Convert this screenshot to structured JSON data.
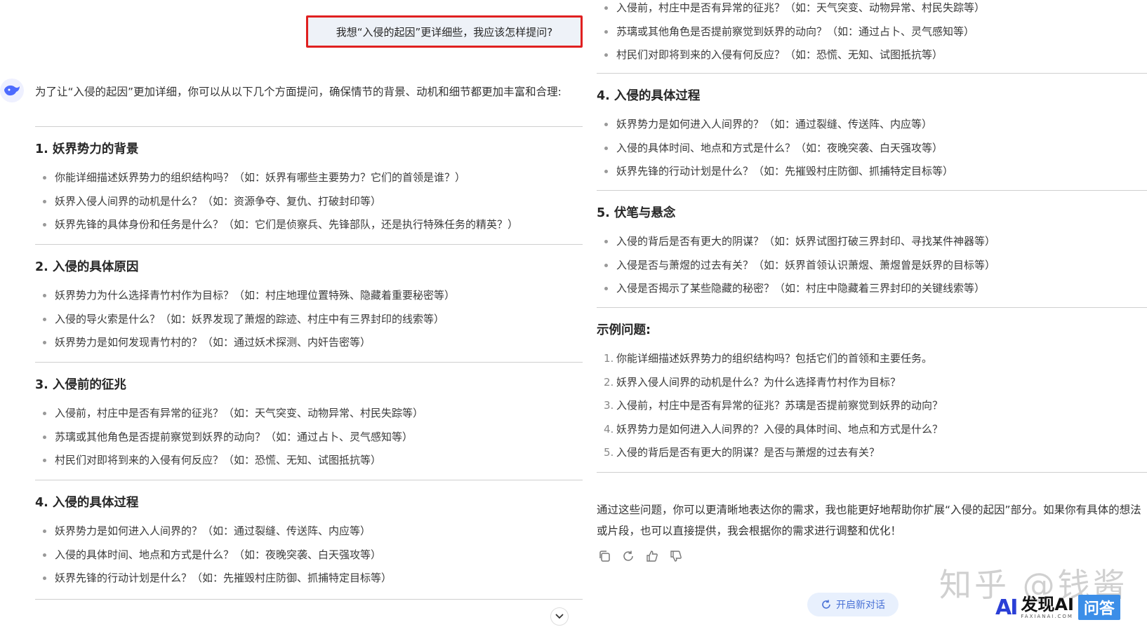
{
  "user_message": "我想“入侵的起因”更详细些，我应该怎样提问?",
  "intro": "为了让“入侵的起因”更加详细，你可以从以下几个方面提问，确保情节的背景、动机和细节都更加丰富和合理:",
  "left_sections": [
    {
      "title": "1. 妖界势力的背景",
      "items": [
        "你能详细描述妖界势力的组织结构吗？（如：妖界有哪些主要势力？它们的首领是谁？）",
        "妖界入侵人间界的动机是什么？（如：资源争夺、复仇、打破封印等）",
        "妖界先锋的具体身份和任务是什么？（如：它们是侦察兵、先锋部队，还是执行特殊任务的精英？）"
      ]
    },
    {
      "title": "2. 入侵的具体原因",
      "items": [
        "妖界势力为什么选择青竹村作为目标？（如：村庄地理位置特殊、隐藏着重要秘密等）",
        "入侵的导火索是什么？（如：妖界发现了萧煜的踪迹、村庄中有三界封印的线索等）",
        "妖界势力是如何发现青竹村的？（如：通过妖术探测、内奸告密等）"
      ]
    },
    {
      "title": "3. 入侵前的征兆",
      "items": [
        "入侵前，村庄中是否有异常的征兆？（如：天气突变、动物异常、村民失踪等）",
        "苏璃或其他角色是否提前察觉到妖界的动向？（如：通过占卜、灵气感知等）",
        "村民们对即将到来的入侵有何反应？（如：恐慌、无知、试图抵抗等）"
      ]
    },
    {
      "title": "4. 入侵的具体过程",
      "items": [
        "妖界势力是如何进入人间界的？（如：通过裂缝、传送阵、内应等）",
        "入侵的具体时间、地点和方式是什么？（如：夜晚突袭、白天强攻等）",
        "妖界先锋的行动计划是什么？（如：先摧毁村庄防御、抓捕特定目标等）"
      ]
    }
  ],
  "right_top_items": [
    "入侵前，村庄中是否有异常的征兆？（如：天气突变、动物异常、村民失踪等）",
    "苏璃或其他角色是否提前察觉到妖界的动向？（如：通过占卜、灵气感知等）",
    "村民们对即将到来的入侵有何反应？（如：恐慌、无知、试图抵抗等）"
  ],
  "right_sections": [
    {
      "title": "4. 入侵的具体过程",
      "items": [
        "妖界势力是如何进入人间界的？（如：通过裂缝、传送阵、内应等）",
        "入侵的具体时间、地点和方式是什么？（如：夜晚突袭、白天强攻等）",
        "妖界先锋的行动计划是什么？（如：先摧毁村庄防御、抓捕特定目标等）"
      ]
    },
    {
      "title": "5. 伏笔与悬念",
      "items": [
        "入侵的背后是否有更大的阴谋？（如：妖界试图打破三界封印、寻找某件神器等）",
        "入侵是否与萧煜的过去有关？（如：妖界首领认识萧煜、萧煜曾是妖界的目标等）",
        "入侵是否揭示了某些隐藏的秘密？（如：村庄中隐藏着三界封印的关键线索等）"
      ]
    }
  ],
  "examples": {
    "title": "示例问题:",
    "items": [
      {
        "num": "1.",
        "text": "你能详细描述妖界势力的组织结构吗？包括它们的首领和主要任务。"
      },
      {
        "num": "2.",
        "text": "妖界入侵人间界的动机是什么？为什么选择青竹村作为目标？"
      },
      {
        "num": "3.",
        "text": "入侵前，村庄中是否有异常的征兆？苏璃是否提前察觉到妖界的动向？"
      },
      {
        "num": "4.",
        "text": "妖界势力是如何进入人间界的？入侵的具体时间、地点和方式是什么？"
      },
      {
        "num": "5.",
        "text": "入侵的背后是否有更大的阴谋？是否与萧煜的过去有关？"
      }
    ]
  },
  "closing": "通过这些问题，你可以更清晰地表达你的需求，我也能更好地帮助你扩展“入侵的起因”部分。如果你有具体的想法或片段，也可以直接提供，我会根据你的需求进行调整和优化！",
  "new_chat_label": "开启新对话",
  "watermark": "知乎 @钱酱",
  "brand": {
    "ai": "AI",
    "main": "发现AI",
    "sub": "FAXIANAI.COM",
    "tag": "问答"
  },
  "icons": {
    "avatar": "deepseek-whale-icon",
    "copy": "copy-icon",
    "regenerate": "refresh-icon",
    "like": "thumbs-up-icon",
    "dislike": "thumbs-down-icon",
    "scroll": "chevron-down-icon",
    "new_chat": "new-chat-icon"
  },
  "colors": {
    "highlight_border": "#e02020",
    "accent": "#4a72d6",
    "brand_blue": "#2b3fd6"
  }
}
